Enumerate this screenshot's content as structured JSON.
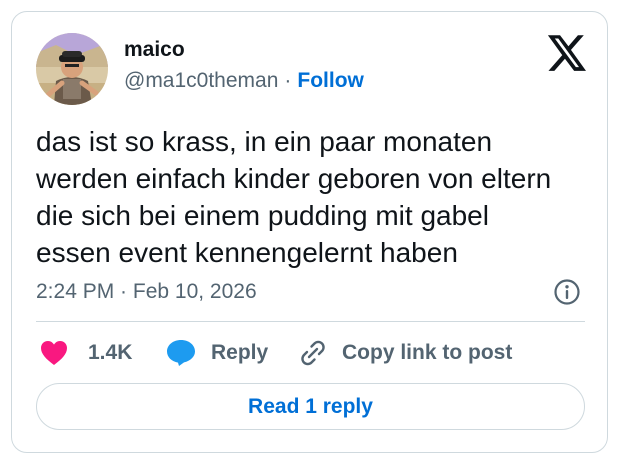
{
  "author": {
    "name": "maico",
    "handle": "@ma1c0theman",
    "separator": "·",
    "follow_label": "Follow"
  },
  "tweet": {
    "text": "das ist so krass, in ein paar monaten\nwerden einfach kinder geboren von eltern\ndie sich bei einem pudding mit gabel\nessen event kennengelernt haben",
    "timestamp": "2:24 PM · Feb 10, 2026"
  },
  "actions": {
    "like_count": "1.4K",
    "reply_label": "Reply",
    "copy_link_label": "Copy link to post"
  },
  "footer": {
    "read_replies_label": "Read 1 reply"
  },
  "icons": {
    "logo": "x-logo-icon",
    "info": "info-icon",
    "like": "heart-icon",
    "reply": "speech-bubble-icon",
    "copy": "link-icon"
  },
  "colors": {
    "accent": "#006fd6",
    "like": "#f91880",
    "reply": "#1d9bf0",
    "text": "#0f1419",
    "muted": "#536471",
    "border": "#cfd9de"
  }
}
